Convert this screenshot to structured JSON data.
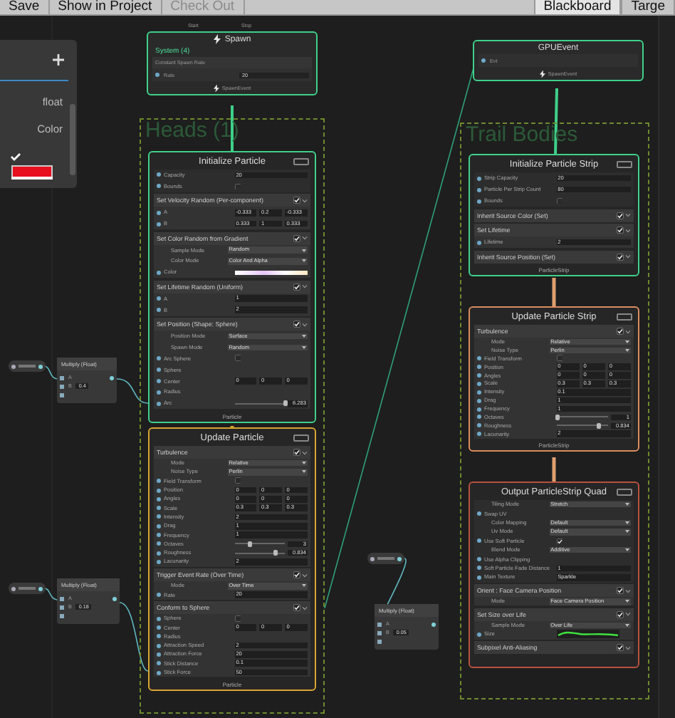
{
  "toolbar": {
    "buttons": [
      {
        "label": "Save",
        "disabled": false
      },
      {
        "label": "Show in Project",
        "disabled": false
      },
      {
        "label": "Check Out",
        "disabled": true
      }
    ],
    "tabs": [
      {
        "label": "Blackboard",
        "selected": true
      },
      {
        "label": "Targe",
        "selected": false
      }
    ]
  },
  "blackboard": {
    "properties": [
      {
        "type_label": "float"
      },
      {
        "type_label": "Color"
      }
    ]
  },
  "groups": [
    {
      "title": "Heads (1)"
    },
    {
      "title": "Trail Bodies"
    }
  ],
  "operators": [
    {
      "kind": "spawn",
      "title": "Spawn",
      "inputs": [
        "Start",
        "Stop"
      ],
      "system": "System (4)",
      "block": "Constant Spawn Rate",
      "rows": [
        {
          "label": "Rate",
          "value": "20"
        }
      ],
      "output": "SpawnEvent"
    },
    {
      "kind": "gpu_event",
      "title": "GPUEvent",
      "rows": [
        {
          "label": "Evt"
        }
      ],
      "output": "SpawnEvent"
    },
    {
      "kind": "multiply",
      "title": "Multiply (Float)",
      "inputs": [
        {
          "label": "A"
        },
        {
          "label": "B",
          "value": "0.4"
        }
      ]
    },
    {
      "kind": "multiply",
      "title": "Multiply (Float)",
      "inputs": [
        {
          "label": "A"
        },
        {
          "label": "B",
          "value": "0.18"
        }
      ]
    },
    {
      "kind": "multiply",
      "title": "Multiply (Float)",
      "inputs": [
        {
          "label": "A"
        },
        {
          "label": "B",
          "value": "0.05"
        }
      ]
    }
  ],
  "contexts": [
    {
      "title": "Initialize Particle",
      "color": "#3fd08a",
      "footer": "Particle",
      "settings": [
        {
          "kind": "field",
          "label": "Capacity",
          "value": "20"
        },
        {
          "kind": "toggle",
          "label": "Bounds",
          "checked": false
        }
      ],
      "blocks": [
        {
          "title": "Set Velocity Random (Per-component)",
          "enabled": true,
          "rows": [
            {
              "kind": "vec3",
              "label": "A",
              "values": [
                "-0.333",
                "0.2",
                "-0.333"
              ]
            },
            {
              "kind": "vec3",
              "label": "B",
              "values": [
                "0.333",
                "1",
                "0.333"
              ]
            }
          ]
        },
        {
          "title": "Set Color Random from Gradient",
          "enabled": true,
          "rows": [
            {
              "kind": "dropdown",
              "label": "Sample Mode",
              "value": "Random"
            },
            {
              "kind": "dropdown",
              "label": "Color Mode",
              "value": "Color And Alpha"
            },
            {
              "kind": "gradient",
              "label": "Color"
            }
          ]
        },
        {
          "title": "Set Lifetime Random (Uniform)",
          "enabled": true,
          "rows": [
            {
              "kind": "field",
              "label": "A",
              "value": "1"
            },
            {
              "kind": "field",
              "label": "B",
              "value": "2"
            }
          ]
        },
        {
          "title": "Set Position (Shape: Sphere)",
          "enabled": true,
          "rows": [
            {
              "kind": "dropdown",
              "label": "Position Mode",
              "value": "Surface"
            },
            {
              "kind": "dropdown",
              "label": "Spawn Mode",
              "value": "Random"
            },
            {
              "kind": "toggle",
              "label": "Arc Sphere",
              "checked": false
            },
            {
              "kind": "label",
              "label": "Sphere"
            },
            {
              "kind": "vec3",
              "label": "Center",
              "values": [
                "0",
                "0",
                "0"
              ]
            },
            {
              "kind": "label",
              "label": "Radius"
            },
            {
              "kind": "slider",
              "label": "Arc",
              "level": 1,
              "value": "6.283"
            }
          ]
        }
      ]
    },
    {
      "title": "Update Particle",
      "color": "#d9a531",
      "footer": "Particle",
      "blocks": [
        {
          "title": "Turbulence",
          "enabled": true,
          "rows": [
            {
              "kind": "dropdown",
              "label": "Mode",
              "value": "Relative"
            },
            {
              "kind": "dropdown",
              "label": "Noise Type",
              "value": "Perlin"
            },
            {
              "kind": "toggle",
              "label": "Field Transform",
              "checked": false
            },
            {
              "kind": "vec3",
              "label": "Position",
              "values": [
                "0",
                "0",
                "0"
              ]
            },
            {
              "kind": "vec3",
              "label": "Angles",
              "values": [
                "0",
                "0",
                "0"
              ]
            },
            {
              "kind": "vec3",
              "label": "Scale",
              "values": [
                "0.3",
                "0.3",
                "0.3"
              ]
            },
            {
              "kind": "field",
              "label": "Intensity",
              "value": "2"
            },
            {
              "kind": "field",
              "label": "Drag",
              "value": "1"
            },
            {
              "kind": "field",
              "label": "Frequency",
              "value": "1"
            },
            {
              "kind": "slider",
              "label": "Octaves",
              "level": 0.3,
              "value": "3"
            },
            {
              "kind": "slider",
              "label": "Roughness",
              "level": 0.83,
              "value": "0.834"
            },
            {
              "kind": "field",
              "label": "Lacunarity",
              "value": "2"
            }
          ]
        },
        {
          "title": "Trigger Event Rate (Over Time)",
          "enabled": true,
          "rows": [
            {
              "kind": "dropdown",
              "label": "Mode",
              "value": "Over Time"
            },
            {
              "kind": "field",
              "label": "Rate",
              "value": "20"
            }
          ]
        },
        {
          "title": "Conform to Sphere",
          "enabled": true,
          "rows": [
            {
              "kind": "toggle",
              "label": "Sphere",
              "checked": false
            },
            {
              "kind": "vec3",
              "label": "Center",
              "values": [
                "0",
                "0",
                "0"
              ]
            },
            {
              "kind": "label",
              "label": "Radius"
            },
            {
              "kind": "field",
              "label": "Attraction Speed",
              "value": "2"
            },
            {
              "kind": "field",
              "label": "Attraction Force",
              "value": "20"
            },
            {
              "kind": "field",
              "label": "Stick Distance",
              "value": "0.1"
            },
            {
              "kind": "field",
              "label": "Stick Force",
              "value": "50"
            }
          ]
        }
      ]
    },
    {
      "title": "Initialize Particle Strip",
      "color": "#3fd08a",
      "footer": "ParticleStrip",
      "settings": [
        {
          "kind": "field",
          "label": "Strip Capacity",
          "value": "20"
        },
        {
          "kind": "field",
          "label": "Particle Per Strip Count",
          "value": "80"
        },
        {
          "kind": "toggle",
          "label": "Bounds",
          "checked": false
        }
      ],
      "blocks": [
        {
          "title": "Inherit Source Color (Set)",
          "enabled": true
        },
        {
          "title": "Set Lifetime",
          "enabled": true,
          "rows": [
            {
              "kind": "field",
              "label": "Lifetime",
              "value": "2"
            }
          ]
        },
        {
          "title": "Inherit Source Position (Set)",
          "enabled": true
        }
      ]
    },
    {
      "title": "Update Particle Strip",
      "color": "#d98c5f",
      "footer": "ParticleStrip",
      "blocks": [
        {
          "title": "Turbulence",
          "enabled": true,
          "rows": [
            {
              "kind": "dropdown",
              "label": "Mode",
              "value": "Relative"
            },
            {
              "kind": "dropdown",
              "label": "Noise Type",
              "value": "Perlin"
            },
            {
              "kind": "toggle",
              "label": "Field Transform",
              "checked": false
            },
            {
              "kind": "vec3",
              "label": "Position",
              "values": [
                "0",
                "0",
                "0"
              ]
            },
            {
              "kind": "vec3",
              "label": "Angles",
              "values": [
                "0",
                "0",
                "0"
              ]
            },
            {
              "kind": "vec3",
              "label": "Scale",
              "values": [
                "0.3",
                "0.3",
                "0.3"
              ]
            },
            {
              "kind": "field",
              "label": "Intensity",
              "value": "0.1"
            },
            {
              "kind": "field",
              "label": "Drag",
              "value": "1"
            },
            {
              "kind": "field",
              "label": "Frequency",
              "value": "1"
            },
            {
              "kind": "slider",
              "label": "Octaves",
              "level": 0.03,
              "value": "1"
            },
            {
              "kind": "slider",
              "label": "Roughness",
              "level": 0.83,
              "value": "0.834"
            },
            {
              "kind": "field",
              "label": "Lacunarity",
              "value": "2"
            }
          ]
        }
      ]
    },
    {
      "title": "Output ParticleStrip Quad",
      "color": "#b5523e",
      "settings": [
        {
          "kind": "dropdown",
          "label": "Tiling Mode",
          "value": "Stretch"
        },
        {
          "kind": "label",
          "label": "Swap UV"
        },
        {
          "kind": "dropdown",
          "label": "Color Mapping",
          "value": "Default"
        },
        {
          "kind": "dropdown",
          "label": "Uv Mode",
          "value": "Default"
        },
        {
          "kind": "toggle",
          "label": "Use Soft Particle",
          "checked": true
        },
        {
          "kind": "dropdown",
          "label": "Blend Mode",
          "value": "Additive"
        },
        {
          "kind": "label",
          "label": "Use Alpha Clipping"
        },
        {
          "kind": "field",
          "label": "Soft Particle Fade Distance",
          "value": "1"
        },
        {
          "kind": "field",
          "label": "Main Texture",
          "value": "Sparkle"
        }
      ],
      "blocks": [
        {
          "title": "Orient : Face Camera Position",
          "enabled": true,
          "rows": [
            {
              "kind": "dropdown",
              "label": "Mode",
              "value": "Face Camera Position"
            }
          ]
        },
        {
          "title": "Set Size over Life",
          "enabled": true,
          "rows": [
            {
              "kind": "dropdown",
              "label": "Sample Mode",
              "value": "Over Life"
            },
            {
              "kind": "curve",
              "label": "Size"
            }
          ]
        },
        {
          "title": "Subpixel Anti-Aliasing",
          "enabled": true
        }
      ]
    }
  ]
}
